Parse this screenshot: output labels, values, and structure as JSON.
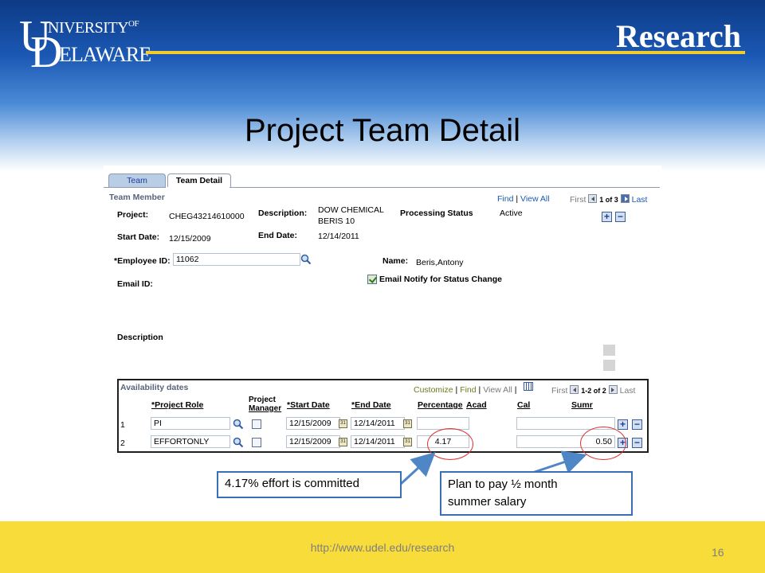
{
  "header": {
    "logo_u": "U",
    "logo_row1": "NIVERSITY",
    "logo_of": "OF",
    "logo_d": "D",
    "logo_row2": "ELAWARE",
    "brand_right": "Research"
  },
  "slide": {
    "title": "Project Team Detail",
    "footer_url": "http://www.udel.edu/research",
    "page_number": "16"
  },
  "tabs": [
    {
      "label": "Team",
      "active": false
    },
    {
      "label": "Team Detail",
      "active": true
    }
  ],
  "team_member": {
    "section_label": "Team Member",
    "nav": {
      "find": "Find",
      "sep": "|",
      "view_all": "View All",
      "first": "First",
      "range": "1 of 3",
      "last": "Last"
    },
    "project_label": "Project:",
    "project_value": "CHEG43214610000",
    "description_label": "Description:",
    "description_line1": "DOW CHEMICAL",
    "description_line2": "BERIS 10",
    "processing_status_label": "Processing Status",
    "processing_status_value": "Active",
    "start_date_label": "Start Date:",
    "start_date_value": "12/15/2009",
    "end_date_label": "End Date:",
    "end_date_value": "12/14/2011",
    "employee_id_label": "*Employee ID:",
    "employee_id_value": "11062",
    "name_label": "Name:",
    "name_value": "Beris,Antony",
    "email_notify_label": "Email Notify for Status Change",
    "email_notify_checked": true,
    "email_id_label": "Email ID:",
    "description_field_label": "Description"
  },
  "availability": {
    "title": "Availability dates",
    "nav": {
      "customize": "Customize",
      "find": "Find",
      "view_all": "View All",
      "sep": "|",
      "first": "First",
      "range": "1-2 of 2",
      "last": "Last"
    },
    "headers": {
      "project_role": "*Project Role",
      "project_manager_line1": "Project",
      "project_manager_line2": "Manager",
      "start_date": "*Start Date",
      "end_date": "*End Date",
      "percentage": "Percentage",
      "acad": "Acad",
      "cal": "Cal",
      "sumr": "Sumr"
    },
    "rows": [
      {
        "num": "1",
        "role": "PI",
        "manager": false,
        "start": "12/15/2009",
        "end": "12/14/2011",
        "percentage": "",
        "sumr": ""
      },
      {
        "num": "2",
        "role": "EFFORTONLY",
        "manager": false,
        "start": "12/15/2009",
        "end": "12/14/2011",
        "percentage": "4.17",
        "sumr": "0.50"
      }
    ],
    "calendar_glyph": "31"
  },
  "callouts": {
    "left": "4.17% effort is committed",
    "right_line1": "Plan to pay ½ month",
    "right_line2": "summer salary"
  },
  "colors": {
    "header_blue": "#1b58b4",
    "gold": "#f2cc2a",
    "footer_yellow": "#f7dc3a",
    "callout_border": "#3b6fb5",
    "oval_red": "#e03030"
  }
}
